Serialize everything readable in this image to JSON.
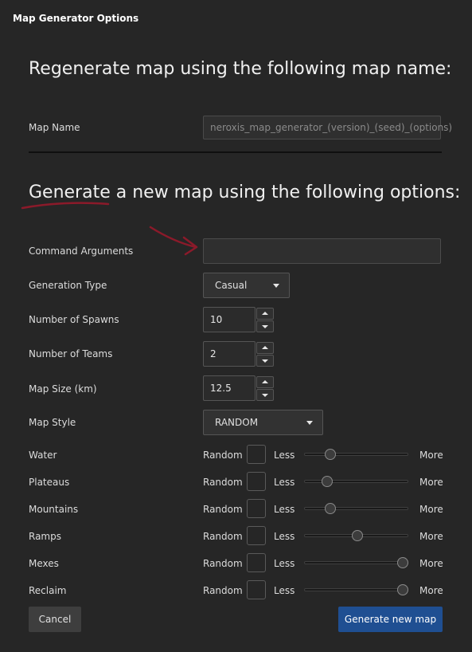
{
  "window": {
    "title": "Map Generator Options"
  },
  "section1": {
    "heading": "Regenerate map using the following map name:",
    "map_name_label": "Map Name",
    "map_name_placeholder": "neroxis_map_generator_(version)_(seed)_(options)"
  },
  "section2": {
    "heading": "Generate a new map using the following options:",
    "command_arguments_label": "Command Arguments",
    "command_arguments_value": "",
    "generation_type_label": "Generation Type",
    "generation_type_value": "Casual",
    "spawns_label": "Number of Spawns",
    "spawns_value": "10",
    "teams_label": "Number of Teams",
    "teams_value": "2",
    "map_size_label": "Map Size (km)",
    "map_size_value": "12.5",
    "map_style_label": "Map Style",
    "map_style_value": "RANDOM"
  },
  "sliders": {
    "random_label": "Random",
    "less_label": "Less",
    "more_label": "More",
    "items": [
      {
        "label": "Water",
        "level": 0.22
      },
      {
        "label": "Plateaus",
        "level": 0.19
      },
      {
        "label": "Mountains",
        "level": 0.22
      },
      {
        "label": "Ramps",
        "level": 0.51
      },
      {
        "label": "Mexes",
        "level": 1.0
      },
      {
        "label": "Reclaim",
        "level": 1.0
      }
    ]
  },
  "buttons": {
    "cancel": "Cancel",
    "generate": "Generate new map"
  },
  "colors": {
    "background": "#262626",
    "primary_button": "#1f4f92",
    "annotation": "#8b1a2a"
  }
}
